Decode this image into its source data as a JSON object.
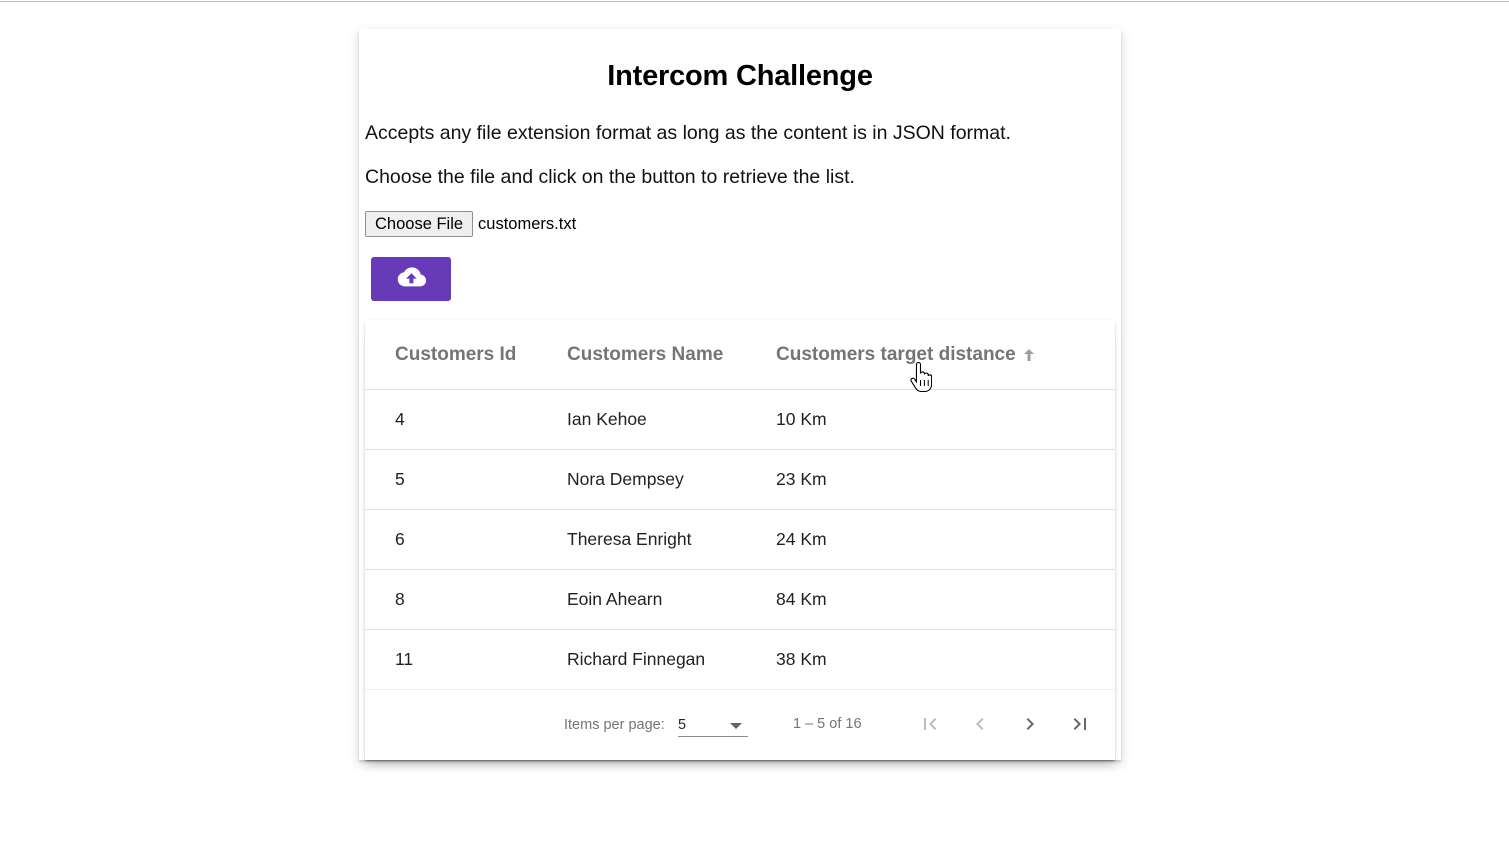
{
  "page": {
    "title": "Intercom Challenge",
    "description_1": "Accepts any file extension format as long as the content is in JSON format.",
    "description_2": "Choose the file and click on the button to retrieve the list."
  },
  "file_input": {
    "button_label": "Choose File",
    "selected_file": "customers.txt"
  },
  "upload_button": {
    "icon": "cloud-upload-icon",
    "color": "#673ab7"
  },
  "table": {
    "columns": [
      "Customers Id",
      "Customers Name",
      "Customers target distance"
    ],
    "sorted_column": "Customers target distance",
    "sort_direction": "ascending",
    "rows": [
      {
        "id": "4",
        "name": "Ian Kehoe",
        "distance": "10 Km"
      },
      {
        "id": "5",
        "name": "Nora Dempsey",
        "distance": "23 Km"
      },
      {
        "id": "6",
        "name": "Theresa Enright",
        "distance": "24 Km"
      },
      {
        "id": "8",
        "name": "Eoin Ahearn",
        "distance": "84 Km"
      },
      {
        "id": "11",
        "name": "Richard Finnegan",
        "distance": "38 Km"
      }
    ]
  },
  "paginator": {
    "items_per_page_label": "Items per page:",
    "items_per_page_value": "5",
    "range_label": "1 – 5 of 16"
  }
}
